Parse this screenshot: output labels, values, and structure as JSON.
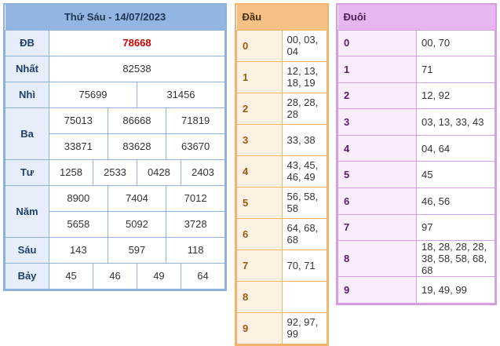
{
  "results": {
    "header": "Thứ Sáu - 14/07/2023",
    "rows": [
      {
        "label": "ĐB",
        "values": [
          "78668"
        ]
      },
      {
        "label": "Nhất",
        "values": [
          "82538"
        ]
      },
      {
        "label": "Nhì",
        "values": [
          "75699",
          "31456"
        ]
      },
      {
        "label": "Ba",
        "values": [
          "75013",
          "86668",
          "71819",
          "33871",
          "83628",
          "63670"
        ]
      },
      {
        "label": "Tư",
        "values": [
          "1258",
          "2533",
          "0428",
          "2403"
        ]
      },
      {
        "label": "Năm",
        "values": [
          "8900",
          "7404",
          "7012",
          "5658",
          "5092",
          "3728"
        ]
      },
      {
        "label": "Sáu",
        "values": [
          "143",
          "597",
          "118"
        ]
      },
      {
        "label": "Bảy",
        "values": [
          "45",
          "46",
          "49",
          "64"
        ]
      }
    ]
  },
  "dau": {
    "header": "Đầu",
    "rows": [
      {
        "key": "0",
        "value": "00, 03, 04"
      },
      {
        "key": "1",
        "value": "12, 13, 18, 19"
      },
      {
        "key": "2",
        "value": "28, 28, 28"
      },
      {
        "key": "3",
        "value": "33, 38"
      },
      {
        "key": "4",
        "value": "43, 45, 46, 49"
      },
      {
        "key": "5",
        "value": "56, 58, 58"
      },
      {
        "key": "6",
        "value": "64, 68, 68"
      },
      {
        "key": "7",
        "value": "70, 71"
      },
      {
        "key": "8",
        "value": ""
      },
      {
        "key": "9",
        "value": "92, 97, 99"
      }
    ]
  },
  "duoi": {
    "header": "Đuôi",
    "rows": [
      {
        "key": "0",
        "value": "00, 70"
      },
      {
        "key": "1",
        "value": "71"
      },
      {
        "key": "2",
        "value": "12, 92"
      },
      {
        "key": "3",
        "value": "03, 13, 33, 43"
      },
      {
        "key": "4",
        "value": "04, 64"
      },
      {
        "key": "5",
        "value": "45"
      },
      {
        "key": "6",
        "value": "46, 56"
      },
      {
        "key": "7",
        "value": "97"
      },
      {
        "key": "8",
        "value": "18, 28, 28, 28, 38, 58, 58, 68, 68"
      },
      {
        "key": "9",
        "value": "19, 49, 99"
      }
    ]
  },
  "colors": {
    "special_prize": "#cc0000",
    "results_border": "#8fb2dd",
    "dau_border": "#f2b46b",
    "duoi_border": "#d79ee3"
  }
}
